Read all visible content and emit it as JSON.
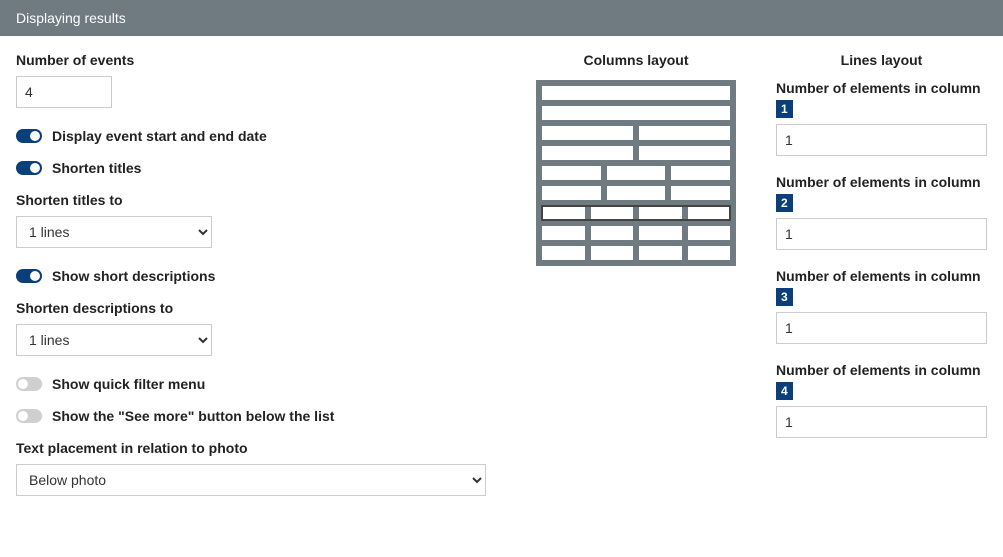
{
  "header": {
    "title": "Displaying results"
  },
  "columnsLayout": {
    "heading": "Columns layout",
    "rows": [
      1,
      1,
      2,
      2,
      3,
      3,
      4,
      4,
      4
    ],
    "selectedIndex": 6
  },
  "linesLayout": {
    "heading": "Lines layout",
    "columns": [
      {
        "label": "Number of elements in column",
        "badge": "1",
        "value": "1"
      },
      {
        "label": "Number of elements in column",
        "badge": "2",
        "value": "1"
      },
      {
        "label": "Number of elements in column",
        "badge": "3",
        "value": "1"
      },
      {
        "label": "Number of elements in column",
        "badge": "4",
        "value": "1"
      }
    ]
  },
  "left": {
    "numberOfEvents": {
      "label": "Number of events",
      "value": "4"
    },
    "displayDates": {
      "label": "Display event start and end date",
      "on": true
    },
    "shortenTitles": {
      "label": "Shorten titles",
      "on": true
    },
    "shortenTitlesTo": {
      "label": "Shorten titles to",
      "value": "1 lines"
    },
    "showShortDesc": {
      "label": "Show short descriptions",
      "on": true
    },
    "shortenDescTo": {
      "label": "Shorten descriptions to",
      "value": "1 lines"
    },
    "quickFilter": {
      "label": "Show quick filter menu",
      "on": false
    },
    "seeMore": {
      "label": "Show the \"See more\" button below the list",
      "on": false
    },
    "textPlacement": {
      "label": "Text placement in relation to photo",
      "value": "Below photo"
    }
  }
}
